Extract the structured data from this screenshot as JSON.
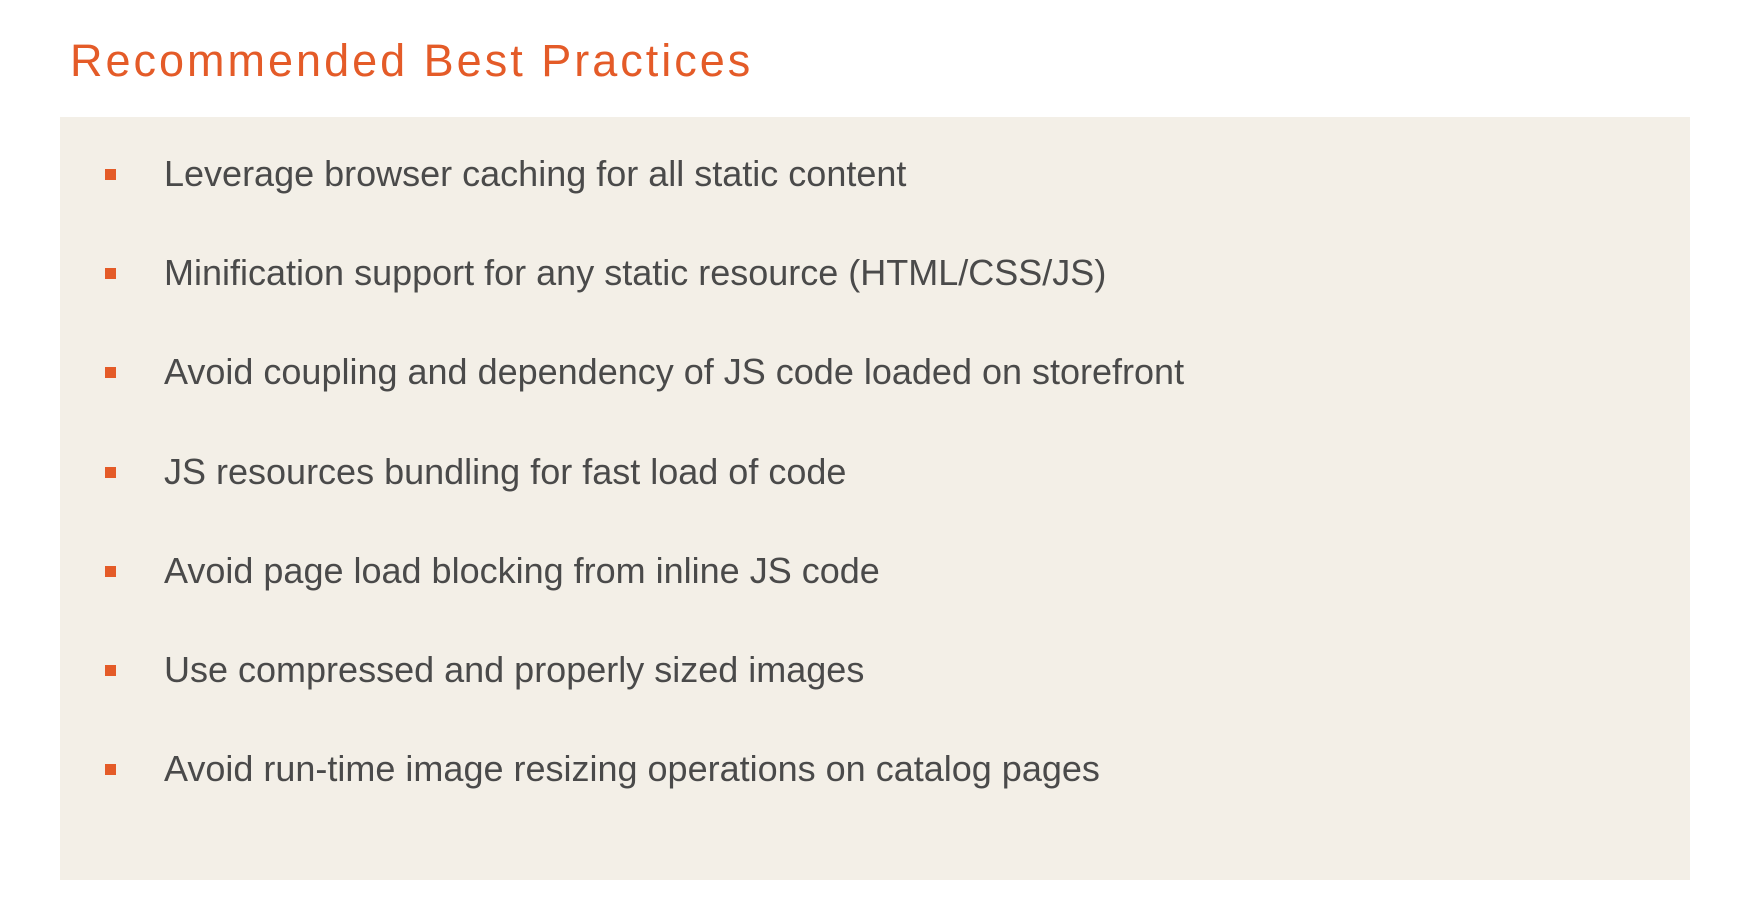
{
  "title": "Recommended Best Practices",
  "bullets": [
    "Leverage browser caching for all static content",
    "Minification support for any static resource (HTML/CSS/JS)",
    "Avoid coupling and dependency of JS code loaded on storefront",
    "JS resources bundling for fast load of code",
    "Avoid page load blocking from inline JS code",
    "Use compressed and properly sized images",
    "Avoid run-time image resizing operations on catalog pages"
  ]
}
